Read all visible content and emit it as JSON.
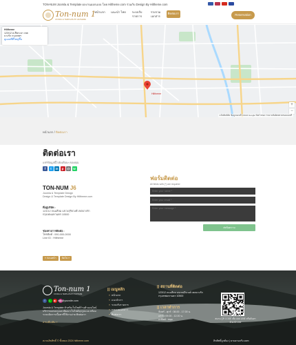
{
  "topbar": {
    "text": "TON-NUM Joomla & Template  ผลงานออกแบบ โดย Hiltheme.com ร่วมกับ Design By Hiltheme.com",
    "flags": [
      {
        "icon": "flag-uk-icon",
        "color": "#3559a8"
      },
      {
        "icon": "flag-th-icon",
        "color": "#b8344d"
      },
      {
        "icon": "flag-cn-icon",
        "color": "#d52b1e"
      },
      {
        "icon": "flag-la-icon",
        "color": "#2b4aa0"
      }
    ]
  },
  "logo": {
    "brand": "Ton-num 1",
    "tagline": "JOOMLA & TEMPLATE BY HILTHEME"
  },
  "nav": [
    {
      "label": "หน้าแรก"
    },
    {
      "label": "แนะนำ ไทย"
    },
    {
      "label": "ระบบรับ รายการ"
    },
    {
      "label": "รวบรวม เอกสาร"
    },
    {
      "label": "ติดต่อเรา"
    }
  ],
  "reserve_button": "Reservation",
  "map": {
    "card_title": "Hiltheme",
    "card_line1": "123/12 ต.สี่พระยา เขต",
    "card_line2": "บางรัก กรุงเทพฯ",
    "card_link": "ดูแผนที่ที่ใหญ่ขึ้น",
    "marker_label": "Hiltheme",
    "footer_copy": "แป้นพิมพ์ลัด  ข้อมูลแผนที่ ©2024 Google  ข้อกำหนด  รายงานข้อผิดพลาดของแผนที่",
    "zoom_in": "+",
    "zoom_out": "−",
    "road_color": "#f7d58a",
    "water_color": "#aadaff",
    "park_color": "#c8e6c9",
    "land_color": "#eef0f2"
  },
  "breadcrumb": {
    "home": "หน้าแรก",
    "sep": "/",
    "current": "ติดต่อเรา"
  },
  "contact": {
    "title": "ติดต่อเรา",
    "share_label": "แชร์ข้อมูลนี้ไปยังเพื่อนๆ ของคุณ",
    "shares": [
      {
        "icon": "facebook-icon",
        "glyph": "f",
        "color": "#3b5998"
      },
      {
        "icon": "twitter-icon",
        "glyph": "t",
        "color": "#1da1f2"
      },
      {
        "icon": "linkedin-icon",
        "glyph": "in",
        "color": "#0077b5"
      },
      {
        "icon": "pinterest-icon",
        "glyph": "p",
        "color": "#cb2027"
      },
      {
        "icon": "email-icon",
        "glyph": "@",
        "color": "#777777"
      },
      {
        "icon": "whatsapp-icon",
        "glyph": "w",
        "color": "#25d366"
      }
    ],
    "company": "TON-NUM",
    "company_suffix": "J6",
    "sub1": "Joomla & Template Design",
    "sub2": "Design & Template Design By Hiltheme.com",
    "address_label": "ที่อยู่บริษัท :",
    "address": "123/12 ถนนสีลม แขวงสุริยวงศ์ เขตบางรัก กรุงเทพมหานคร 10500",
    "contact_label": "ช่องทางการติดต่อ :",
    "phone": "โทรศัพท์ : 090-000-0000",
    "line": "Line ID : Hiltheme",
    "prev": "« ก่อนหน้า",
    "next": "ถัดไป »"
  },
  "form": {
    "title": "ฟอร์มติดต่อ",
    "note": "All fields with (*) are required",
    "name_placeholder": "Enter your name *",
    "email_placeholder": "Enter your email *",
    "message_placeholder": "Enter your message *",
    "send": "ส่งข้อความ"
  },
  "footer": {
    "brand": "Ton-num 1",
    "tagline": "JOOMLA & TEMPLATE BY HILTHEME",
    "socials": [
      {
        "icon": "facebook-icon",
        "glyph": "f",
        "color": "#3b5998"
      },
      {
        "icon": "line-icon",
        "glyph": "L",
        "color": "#00b900"
      },
      {
        "icon": "youtube-icon",
        "glyph": "▶",
        "color": "#e62117"
      },
      {
        "icon": "instagram-icon",
        "glyph": "◎",
        "color": "#c13584"
      }
    ],
    "email": "info@yoursite.com",
    "description": "Joomla & Template สำหรับเว็บไซต์ร้านค้าออนไลน์ บริการออกแบบและพัฒนาเว็บไซต์ทุกรูปแบบ พร้อมระบบจัดการเนื้อหาที่ใช้งานง่าย ติดต่อเรา",
    "more": "อ่านเพิ่มเติม »",
    "links_title": "เมนูหลัก",
    "links": [
      "หน้าแรก",
      "แนะนำเรา",
      "ระบบรับรายการ",
      "รวบรวมเอกสาร",
      "ติดต่อเรา"
    ],
    "address_title": "สถานที่ติดต่อ",
    "address": "123/12 ถนนสีลม แขวงสุริยวงศ์ เขตบางรัก กรุงเทพมหานคร 10500",
    "hours_title": "เวลาทำการ",
    "hours1": "จันทร์ - ศุกร์ : 08.00 - 17.00 น.",
    "hours2": "เสาร์ : 09.00 - 12.00 น.",
    "hours3": "อาทิตย์ : หยุด",
    "qr_text": "สแกน QR CODE เพื่อ Add LINE หรือค้นหาด้วย ID Line",
    "copyright": "สงวนลิขสิทธิ์ © ทั้งหมด 2024 hiltheme.com",
    "bottom_right": "ลิขสิทธิ์ถูกต้อง | ยามยามจริง.com"
  }
}
